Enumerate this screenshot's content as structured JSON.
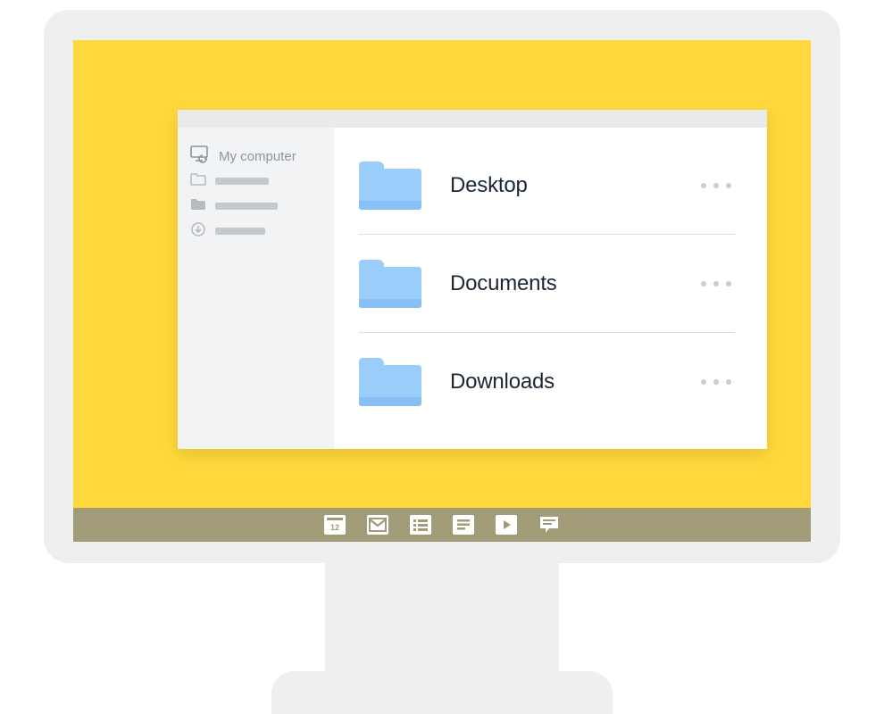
{
  "sidebar": {
    "primary_label": "My computer"
  },
  "folders": [
    {
      "name": "Desktop"
    },
    {
      "name": "Documents"
    },
    {
      "name": "Downloads"
    }
  ],
  "taskbar": {
    "items": [
      "calendar",
      "mail",
      "list",
      "document",
      "play",
      "comment"
    ]
  }
}
